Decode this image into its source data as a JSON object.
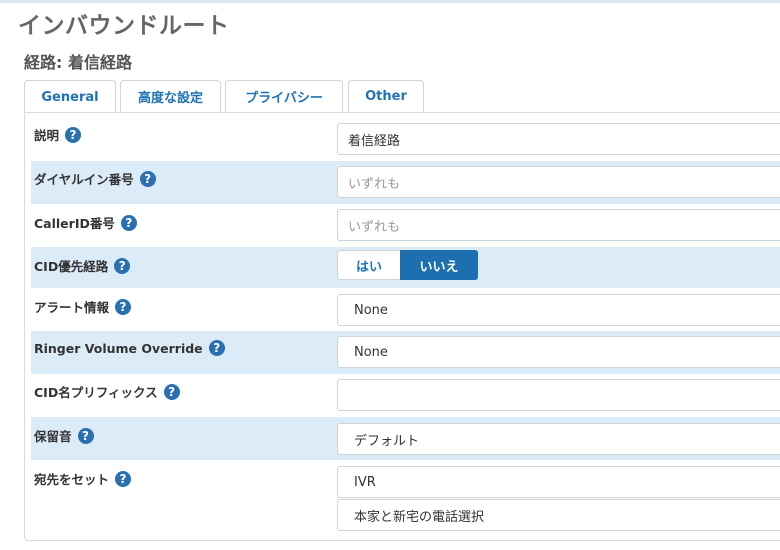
{
  "page": {
    "title": "インバウンドルート",
    "route_label": "経路: 着信経路"
  },
  "tabs": [
    {
      "label": "General",
      "active": true
    },
    {
      "label": "高度な設定",
      "active": false
    },
    {
      "label": "プライバシー",
      "active": false
    },
    {
      "label": "Other",
      "active": false
    }
  ],
  "form": {
    "description": {
      "label": "説明",
      "value": "着信経路"
    },
    "did_number": {
      "label": "ダイヤルイン番号",
      "placeholder": "いずれも"
    },
    "callerid_number": {
      "label": "CallerID番号",
      "placeholder": "いずれも"
    },
    "cid_priority": {
      "label": "CID優先経路",
      "options": [
        "はい",
        "いいえ"
      ],
      "selected": "いいえ"
    },
    "alert_info": {
      "label": "アラート情報",
      "value": "None"
    },
    "ringer_volume": {
      "label": "Ringer Volume Override",
      "value": "None"
    },
    "cid_name_prefix": {
      "label": "CID名プリフィックス",
      "value": ""
    },
    "music_on_hold": {
      "label": "保留音",
      "value": "デフォルト"
    },
    "destination": {
      "label": "宛先をセット",
      "type_value": "IVR",
      "target_value": "本家と新宅の電話選択"
    }
  },
  "icons": {
    "help": "question-circle-icon"
  },
  "colors": {
    "accent": "#1f73b5",
    "row_shade": "#dbebf8",
    "help_icon": "#2a6fb0"
  }
}
